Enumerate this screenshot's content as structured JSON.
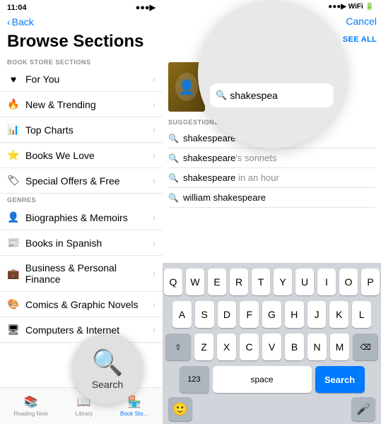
{
  "left": {
    "statusBar": {
      "time": "11:04",
      "signal": "▲▼"
    },
    "backLabel": "Back",
    "pageTitle": "Browse Sections",
    "sectionLabel1": "BOOK STORE SECTIONS",
    "menuItems": [
      {
        "icon": "♥",
        "label": "For You"
      },
      {
        "icon": "🔥",
        "label": "New & Trending"
      },
      {
        "icon": "📊",
        "label": "Top Charts"
      },
      {
        "icon": "⭐",
        "label": "Books We Love"
      },
      {
        "icon": "🏷",
        "label": "Special Offers & Free"
      }
    ],
    "sectionLabel2": "GENRES",
    "genreItems": [
      {
        "icon": "🔍",
        "label": "Biographies & Memoirs"
      },
      {
        "icon": "📰",
        "label": "Books in Spanish"
      },
      {
        "icon": "💼",
        "label": "Business & Personal Finance"
      },
      {
        "icon": "🎨",
        "label": "Comics & Graphic Novels"
      },
      {
        "icon": "🖥",
        "label": "Computers & Internet"
      }
    ],
    "bottomNav": [
      {
        "icon": "📚",
        "label": "Reading Now",
        "active": false
      },
      {
        "icon": "📖",
        "label": "Library",
        "active": false
      },
      {
        "icon": "🏪",
        "label": "Book Sto…",
        "active": true
      }
    ],
    "searchCircle": {
      "searchLabel": "Search"
    }
  },
  "right": {
    "searchBar": {
      "placeholder": "shakespea",
      "cancelLabel": "Cancel",
      "seeAllLabel": "SEE ALL"
    },
    "suggestions": {
      "label": "SUGGESTIONS",
      "items": [
        {
          "bold": "shakespeare",
          "rest": ""
        },
        {
          "bold": "shakespeare",
          "rest": "'s sonnets"
        },
        {
          "bold": "shakespeare",
          "rest": " in an hour"
        },
        {
          "bold": "william shakespeare",
          "rest": ""
        }
      ]
    },
    "keyboard": {
      "row1": [
        "Q",
        "W",
        "E",
        "R",
        "T",
        "Y",
        "U",
        "I",
        "O",
        "P"
      ],
      "row2": [
        "A",
        "S",
        "D",
        "F",
        "G",
        "H",
        "J",
        "K",
        "L"
      ],
      "row3": [
        "Z",
        "X",
        "C",
        "V",
        "B",
        "N",
        "M"
      ],
      "numLabel": "123",
      "spaceLabel": "space",
      "searchLabel": "Search",
      "deleteIcon": "⌫"
    }
  }
}
